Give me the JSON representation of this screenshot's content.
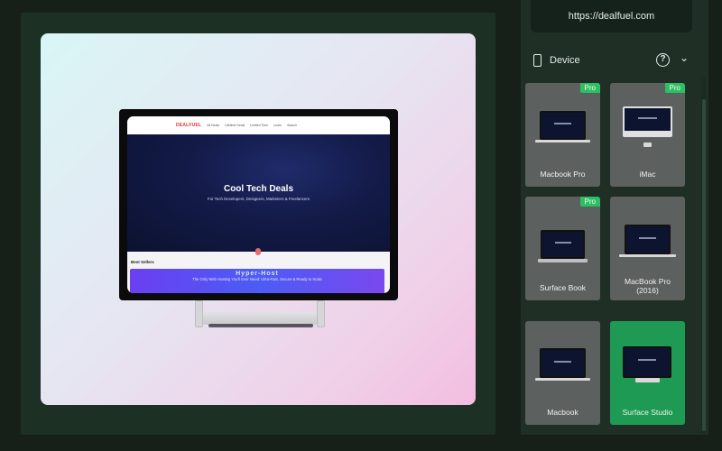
{
  "preview": {
    "site": {
      "logo": "DEALFUEL",
      "nav": [
        "All Deals",
        "Lifetime Deals",
        "Limited Time",
        "Learn",
        "Search"
      ],
      "hero_title": "Cool Tech Deals",
      "hero_subtitle": "For Tech Developers, Designers, Marketers & Freelancers",
      "section_label": "Best Sellers",
      "banner_title": "Hyper-Host",
      "banner_subtitle": "The Only Web Hosting You'll Ever Need: Ultra-Fast, Secure & Ready to Scale"
    }
  },
  "sidebar": {
    "url": "https://dealfuel.com",
    "section_title": "Device",
    "help_icon": "?",
    "chevron_icon": "⌄",
    "pro_label": "Pro",
    "devices": [
      {
        "label": "Macbook Pro",
        "pro": true,
        "selected": false
      },
      {
        "label": "iMac",
        "pro": true,
        "selected": false
      },
      {
        "label": "Surface Book",
        "pro": true,
        "selected": false
      },
      {
        "label": "MacBook Pro\n(2016)",
        "pro": false,
        "selected": false
      },
      {
        "label": "Macbook",
        "pro": false,
        "selected": false
      },
      {
        "label": "Surface Studio",
        "pro": false,
        "selected": true
      }
    ]
  },
  "colors": {
    "accent": "#1e9a55",
    "pro_badge": "#2fbf63",
    "panel": "#1c3024"
  }
}
